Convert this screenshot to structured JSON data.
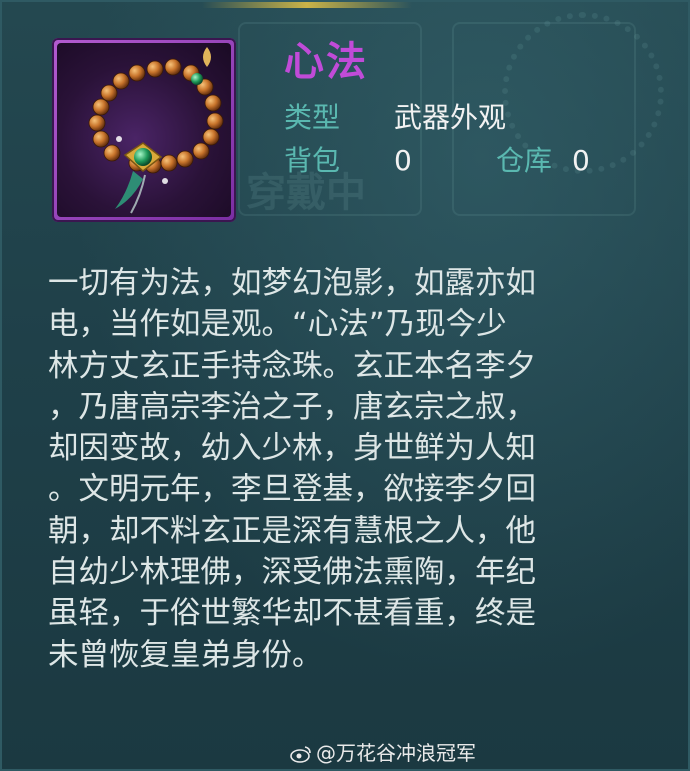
{
  "item": {
    "name": "心法",
    "icon": "prayer-beads-icon",
    "rarity_color": "#c04bd8"
  },
  "stats": {
    "type_label": "类型",
    "type_value": "武器外观",
    "bag_label": "背包",
    "bag_value": "0",
    "warehouse_label": "仓库",
    "warehouse_value": "0"
  },
  "description_lines": [
    "一切有为法，如梦幻泡影，如露亦如",
    "电，当作如是观。“心法”乃现今少",
    "林方丈玄正手持念珠。玄正本名李夕",
    "，乃唐高宗李治之子，唐玄宗之叔，",
    "却因变故，幼入少林，身世鲜为人知",
    "。文明元年，李旦登基，欲接李夕回",
    "朝，却不料玄正是深有慧根之人，他",
    "自幼少林理佛，深受佛法熏陶，年纪",
    "虽轻，于俗世繁华却不甚看重，终是",
    "未曾恢复皇弟身份。"
  ],
  "watermark": "@万花谷冲浪冠军",
  "colors": {
    "label": "#5ab8b0",
    "value": "#f2f2f2",
    "text": "#dde6e6",
    "panel": "#1f4049"
  }
}
